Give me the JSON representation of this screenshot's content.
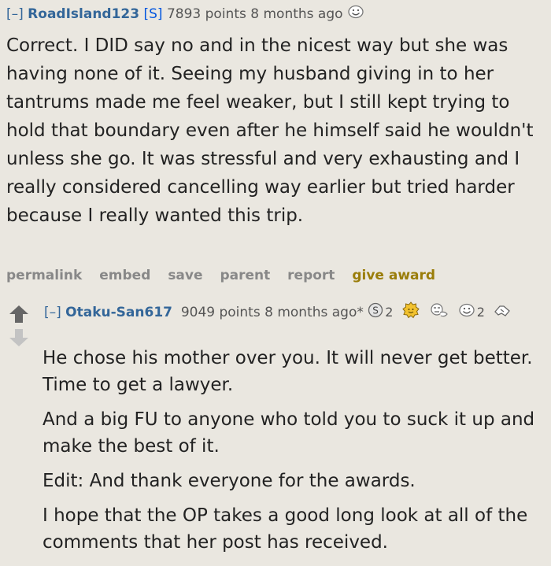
{
  "comment1": {
    "collapse": "[–]",
    "author": "RoadIsland123",
    "op_badge": "[S]",
    "points": "7893 points",
    "age": "8 months ago",
    "award_icon": "smiley-award-icon",
    "paragraphs": [
      "Correct. I DID say no and in the nicest way but she was having none of it. Seeing my husband giving in to her tantrums made me feel weaker, but I still kept trying to hold that boundary even after he himself said he wouldn't unless she go. It was stressful and very exhausting and I really considered cancelling way earlier but tried harder because I really wanted this trip."
    ],
    "buttons": {
      "permalink": "permalink",
      "embed": "embed",
      "save": "save",
      "parent": "parent",
      "report": "report",
      "give_award": "give award"
    }
  },
  "comment2": {
    "collapse": "[–]",
    "author": "Otaku-San617",
    "points": "9049 points",
    "age": "8 months ago*",
    "awards": [
      {
        "icon": "silver-award-icon",
        "count": "2"
      },
      {
        "icon": "gold-award-icon",
        "count": ""
      },
      {
        "icon": "thinking-award-icon",
        "count": ""
      },
      {
        "icon": "smiley-award-icon",
        "count": "2"
      },
      {
        "icon": "handshake-award-icon",
        "count": ""
      }
    ],
    "paragraphs": [
      "He chose his mother over you. It will never get better. Time to get a lawyer.",
      "And a big FU to anyone who told you to suck it up and make the best of it.",
      "Edit: And thank everyone for the awards.",
      "I hope that the OP takes a good long look at all of the comments that her post has received."
    ]
  },
  "colors": {
    "background": "#eae7e0",
    "author": "#336699",
    "op_badge": "#0055df",
    "give_award": "#9a7d0a",
    "meta": "#888888"
  }
}
